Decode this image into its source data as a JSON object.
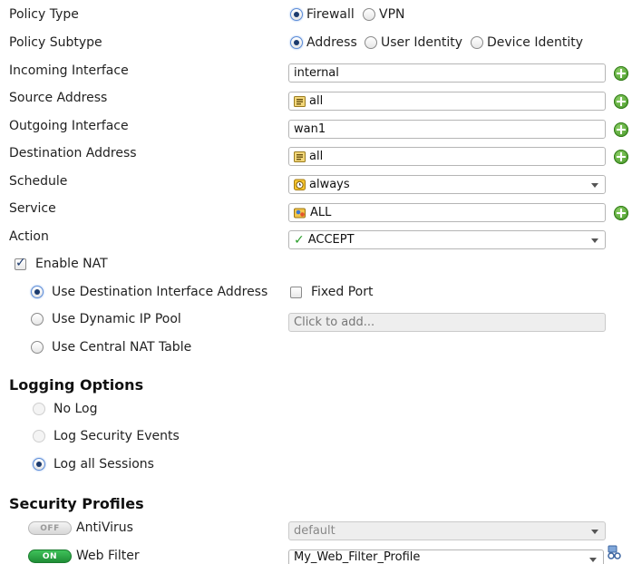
{
  "policy_type": {
    "label": "Policy Type",
    "options": [
      "Firewall",
      "VPN"
    ],
    "selected": "Firewall"
  },
  "policy_subtype": {
    "label": "Policy Subtype",
    "options": [
      "Address",
      "User Identity",
      "Device Identity"
    ],
    "selected": "Address"
  },
  "incoming_interface": {
    "label": "Incoming Interface",
    "value": "internal"
  },
  "source_address": {
    "label": "Source Address",
    "value": "all"
  },
  "outgoing_interface": {
    "label": "Outgoing Interface",
    "value": "wan1"
  },
  "destination_address": {
    "label": "Destination Address",
    "value": "all"
  },
  "schedule": {
    "label": "Schedule",
    "value": "always"
  },
  "service": {
    "label": "Service",
    "value": "ALL"
  },
  "action": {
    "label": "Action",
    "value": "ACCEPT"
  },
  "nat": {
    "enable_label": "Enable NAT",
    "enabled": true,
    "options": [
      "Use Destination Interface Address",
      "Use Dynamic IP Pool",
      "Use Central NAT Table"
    ],
    "selected": "Use Destination Interface Address",
    "fixed_port_label": "Fixed Port",
    "fixed_port": false,
    "ip_pool_placeholder": "Click to add..."
  },
  "logging": {
    "title": "Logging Options",
    "options": [
      "No Log",
      "Log Security Events",
      "Log all Sessions"
    ],
    "selected": "Log all Sessions"
  },
  "security_profiles": {
    "title": "Security Profiles",
    "antivirus": {
      "toggle": "OFF",
      "label": "AntiVirus",
      "value": "default"
    },
    "web_filter": {
      "toggle": "ON",
      "label": "Web Filter",
      "value": "My_Web_Filter_Profile"
    }
  },
  "icons": {
    "add": "add-circle-icon",
    "address": "address-object-icon",
    "schedule": "schedule-clock-icon",
    "service": "service-group-icon",
    "accept": "checkmark-icon",
    "profile_edit": "profile-edit-icon"
  },
  "colors": {
    "add_green": "#3c8d1e",
    "toggle_on": "#1f8e36",
    "radio_dot": "#1b3a6d",
    "accept_check": "#2a9d2a"
  }
}
